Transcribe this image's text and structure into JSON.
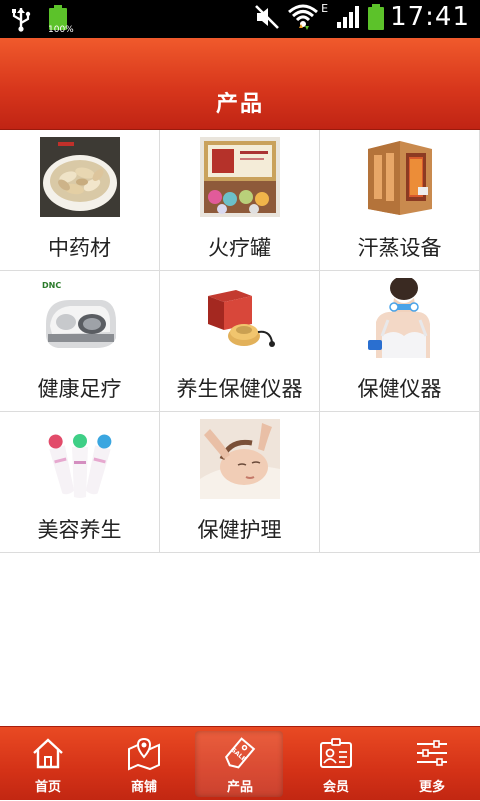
{
  "status_bar": {
    "battery_left_percent": "100%",
    "network_type": "E",
    "time": "17:41"
  },
  "header": {
    "title": "产品"
  },
  "products": [
    {
      "label": "中药材",
      "icon": "herbal-slices-image"
    },
    {
      "label": "火疗罐",
      "icon": "fire-cupping-jars-image"
    },
    {
      "label": "汗蒸设备",
      "icon": "sauna-room-image"
    },
    {
      "label": "健康足疗",
      "icon": "foot-massager-image"
    },
    {
      "label": "养生保健仪器",
      "icon": "health-device-box-image"
    },
    {
      "label": "保健仪器",
      "icon": "neck-massager-woman-image"
    },
    {
      "label": "美容养生",
      "icon": "beauty-wands-image"
    },
    {
      "label": "保健护理",
      "icon": "facial-massage-image"
    }
  ],
  "product_thumb_texts": {
    "foot_massager_brand": "DNC"
  },
  "bottom_nav": {
    "items": [
      {
        "label": "首页",
        "icon": "home-icon"
      },
      {
        "label": "商铺",
        "icon": "shop-map-icon"
      },
      {
        "label": "产品",
        "icon": "sale-tag-icon",
        "badge": "SALE"
      },
      {
        "label": "会员",
        "icon": "member-card-icon"
      },
      {
        "label": "更多",
        "icon": "sliders-icon"
      }
    ],
    "active_index": 2
  },
  "colors": {
    "header_red": "#d8371c",
    "nav_red": "#d43217",
    "grid_line": "#dcdcdc",
    "label_text": "#222222"
  }
}
